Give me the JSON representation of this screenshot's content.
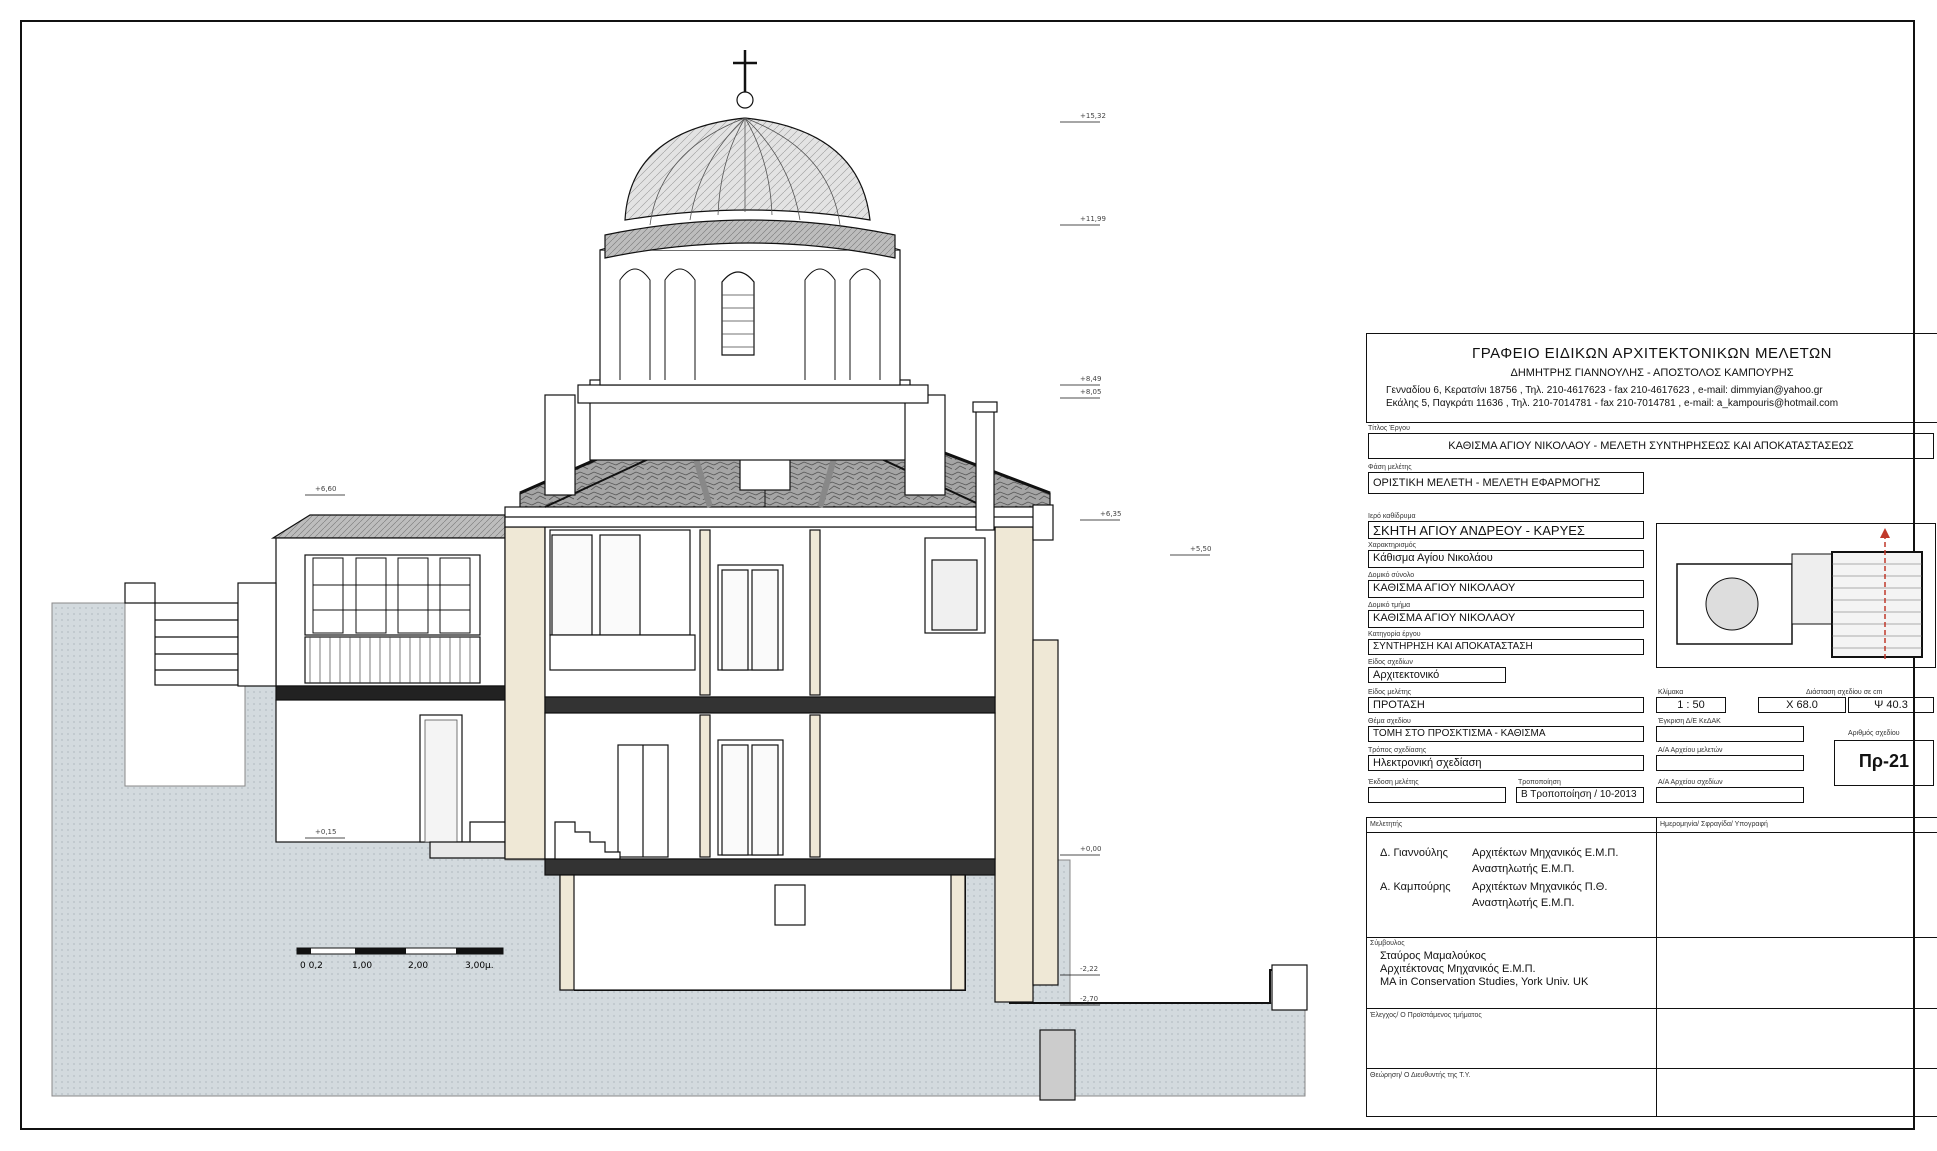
{
  "office": {
    "title": "ΓΡΑΦΕΙΟ ΕΙΔΙΚΩΝ ΑΡΧΙΤΕΚΤΟΝΙΚΩΝ ΜΕΛΕΤΩΝ",
    "partners": "ΔΗΜΗΤΡΗΣ ΓΙΑΝΝΟΥΛΗΣ  -  ΑΠΟΣΤΟΛΟΣ ΚΑΜΠΟΥΡΗΣ",
    "address1": "Γενναδίου 6, Κερατσίνι 18756 , Τηλ. 210-4617623 - fax 210-4617623 , e-mail: dimmyian@yahoo.gr",
    "address2": "Εκάλης 5, Παγκράτι 11636 , Τηλ. 210-7014781 - fax 210-7014781 , e-mail: a_kampouris@hotmail.com"
  },
  "fields": {
    "project_title_label": "Τίτλος Έργου",
    "project_title": "ΚΑΘΙΣΜΑ ΑΓΙΟΥ ΝΙΚΟΛΑΟΥ - ΜΕΛΕΤΗ ΣΥΝΤΗΡΗΣΕΩΣ ΚΑΙ ΑΠΟΚΑΤΑΣΤΑΣΕΩΣ",
    "phase_label": "Φάση μελέτης",
    "phase": "ΟΡΙΣΤΙΚΗ ΜΕΛΕΤΗ - ΜΕΛΕΤΗ ΕΦΑΡΜΟΓΗΣ",
    "monastery_label": "Ιερό καθίδρυμα",
    "monastery": "ΣΚΗΤΗ ΑΓΙΟΥ ΑΝΔΡΕΟΥ - ΚΑΡΥΕΣ",
    "feature_label": "Χαρακτηρισμός",
    "feature": "Κάθισμα Αγίου Νικολάου",
    "complex_label": "Δομικό σύνολο",
    "complex": "ΚΑΘΙΣΜΑ ΑΓΙΟΥ ΝΙΚΟΛΑΟΥ",
    "part_label": "Δομικό τμήμα",
    "part": "ΚΑΘΙΣΜΑ ΑΓΙΟΥ ΝΙΚΟΛΑΟΥ",
    "category_label": "Κατηγορία έργου",
    "category": "ΣΥΝΤΗΡΗΣΗ ΚΑΙ ΑΠΟΚΑΤΑΣΤΑΣΗ",
    "drawing_type_label": "Είδος σχεδίων",
    "drawing_type": "Αρχιτεκτονικό",
    "study_type_label": "Είδος μελέτης",
    "study_type": "ΠΡΟΤΑΣΗ",
    "scale_label": "Κλίμακα",
    "scale": "1 : 50",
    "dims_label": "Διάσταση σχεδίου σε cm",
    "dim_x": "Χ  68.0",
    "dim_y": "Ψ  40.3",
    "subject_label": "Θέμα σχεδίου",
    "subject": "ΤΟΜΗ ΣΤΟ ΠΡΟΣΚΤΙΣΜΑ - ΚΑΘΙΣΜΑ",
    "approval_label": "Έγκριση Δ/Ε ΚεΔΑΚ",
    "method_label": "Τρόπος σχεδίασης",
    "method": "Ηλεκτρονική σχεδίαση",
    "archive_studies_label": "Α/Α Αρχείου μελετών",
    "drawing_no_label": "Αριθμός σχεδίου",
    "drawing_no": "Πρ-21",
    "issue_label": "Έκδοση μελέτης",
    "revision_label": "Τροποποίηση",
    "revision": "Β Τροποποίηση / 10-2013",
    "archive_drawings_label": "Α/Α Αρχείου σχεδίων",
    "designers_label": "Μελετητής",
    "date_label": "Ημερομηνία/ Σφραγίδα/ Υπογραφή",
    "designer1_name": "Δ. Γιαννούλης",
    "designer1_role1": "Αρχιτέκτων Μηχανικός Ε.Μ.Π.",
    "designer1_role2": "Αναστηλωτής Ε.Μ.Π.",
    "designer2_name": "Α. Καμπούρης",
    "designer2_role1": "Αρχιτέκτων Μηχανικός Π.Θ.",
    "designer2_role2": "Αναστηλωτής Ε.Μ.Π.",
    "consultant_label": "Σύμβουλος",
    "consultant_name": "Σταύρος  Μαμαλούκος",
    "consultant_role1": "Αρχιτέκτονας Μηχανικός Ε.Μ.Π.",
    "consultant_role2": "MA in Conservation Studies, York Univ. UK",
    "check_label": "Έλεγχος/ Ο Προϊστάμενος τμήματος",
    "endorse_label": "Θεώρηση/ Ο Διευθυντής της Τ.Υ."
  },
  "scale_bar": {
    "labels": [
      "0 0,2",
      "1,00",
      "2,00",
      "3,00μ."
    ]
  },
  "levels": [
    "+15,32",
    "+11,99",
    "+8,49",
    "+8,05",
    "+6,35",
    "+5,50",
    "+6,60",
    "+0,15",
    "+0,00",
    "-2,22",
    "-2,70"
  ],
  "colors": {
    "wall_fill": "#efe8d6",
    "ground_fill": "#cfd6da",
    "line": "#111111",
    "axis_red": "#c0392b"
  }
}
